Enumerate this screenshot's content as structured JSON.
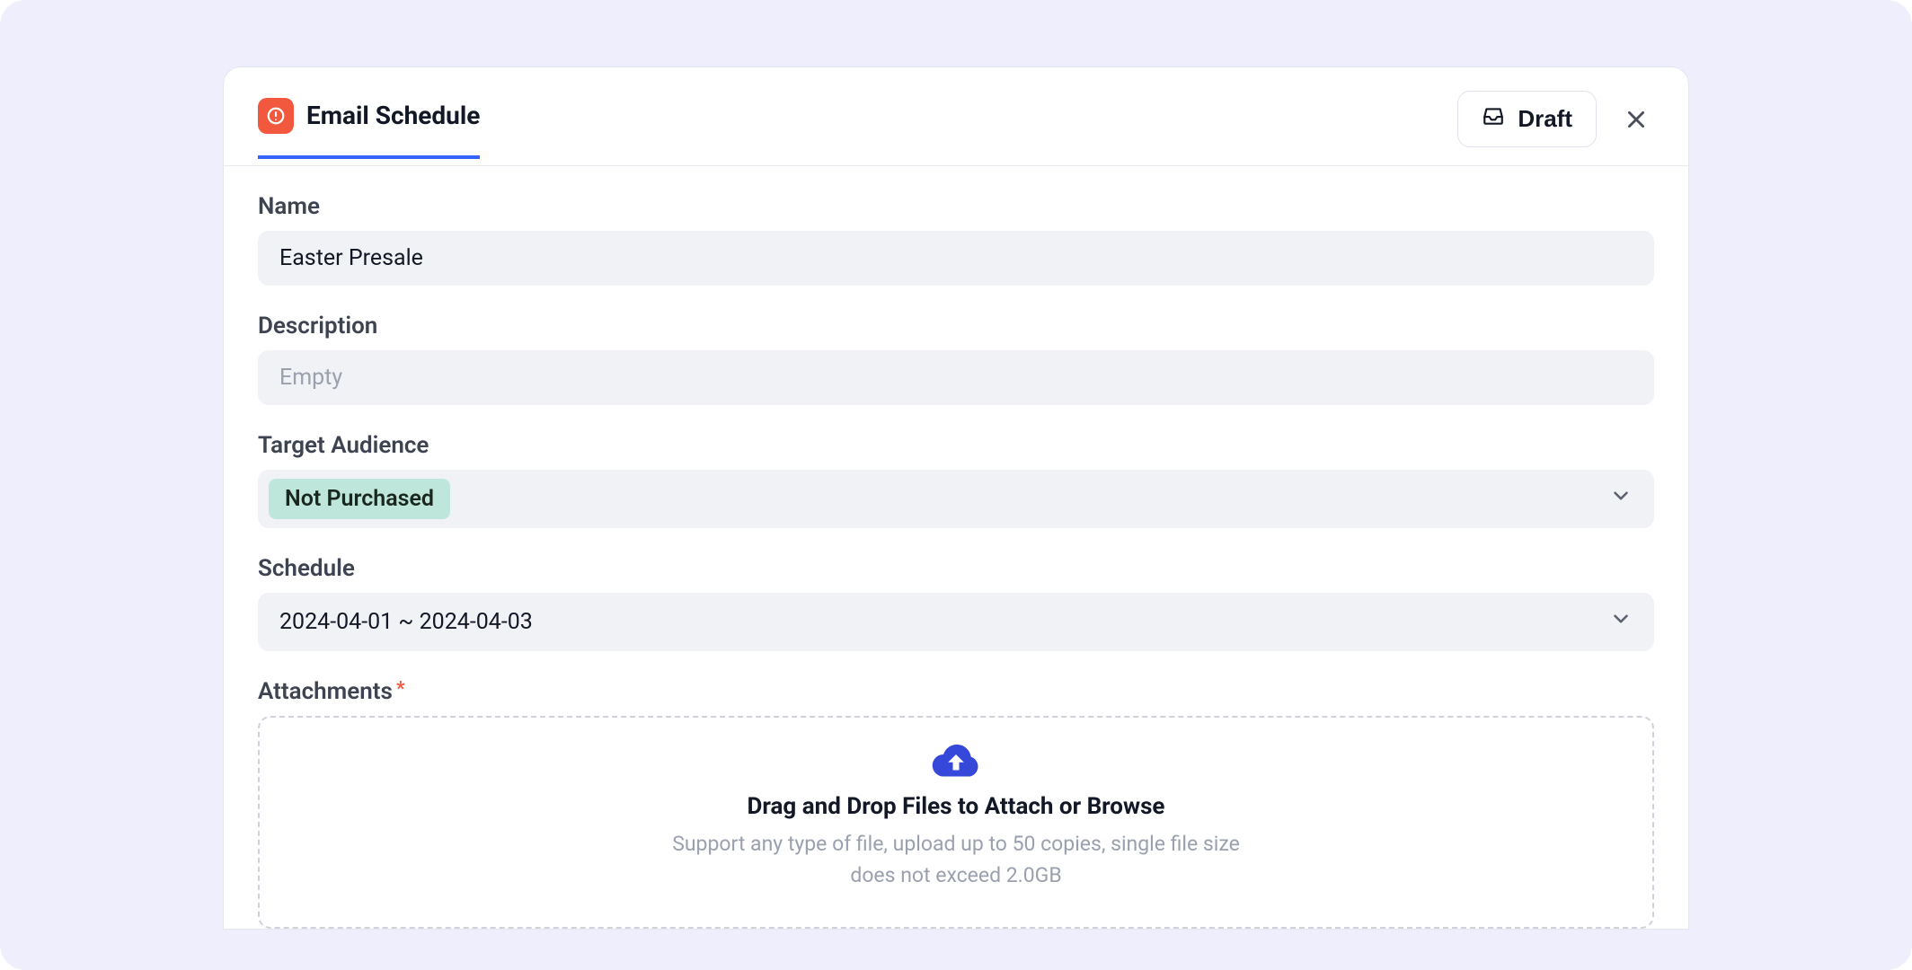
{
  "header": {
    "tab_title": "Email Schedule",
    "draft_label": "Draft"
  },
  "fields": {
    "name": {
      "label": "Name",
      "value": "Easter Presale"
    },
    "description": {
      "label": "Description",
      "placeholder": "Empty"
    },
    "audience": {
      "label": "Target Audience",
      "chip": "Not Purchased"
    },
    "schedule": {
      "label": "Schedule",
      "value": "2024-04-01 ~ 2024-04-03"
    },
    "attachments": {
      "label": "Attachments",
      "dz_title": "Drag and Drop Files to Attach or Browse",
      "dz_sub": "Support any type of file, upload up to 50 copies, single file size does not exceed 2.0GB"
    }
  }
}
